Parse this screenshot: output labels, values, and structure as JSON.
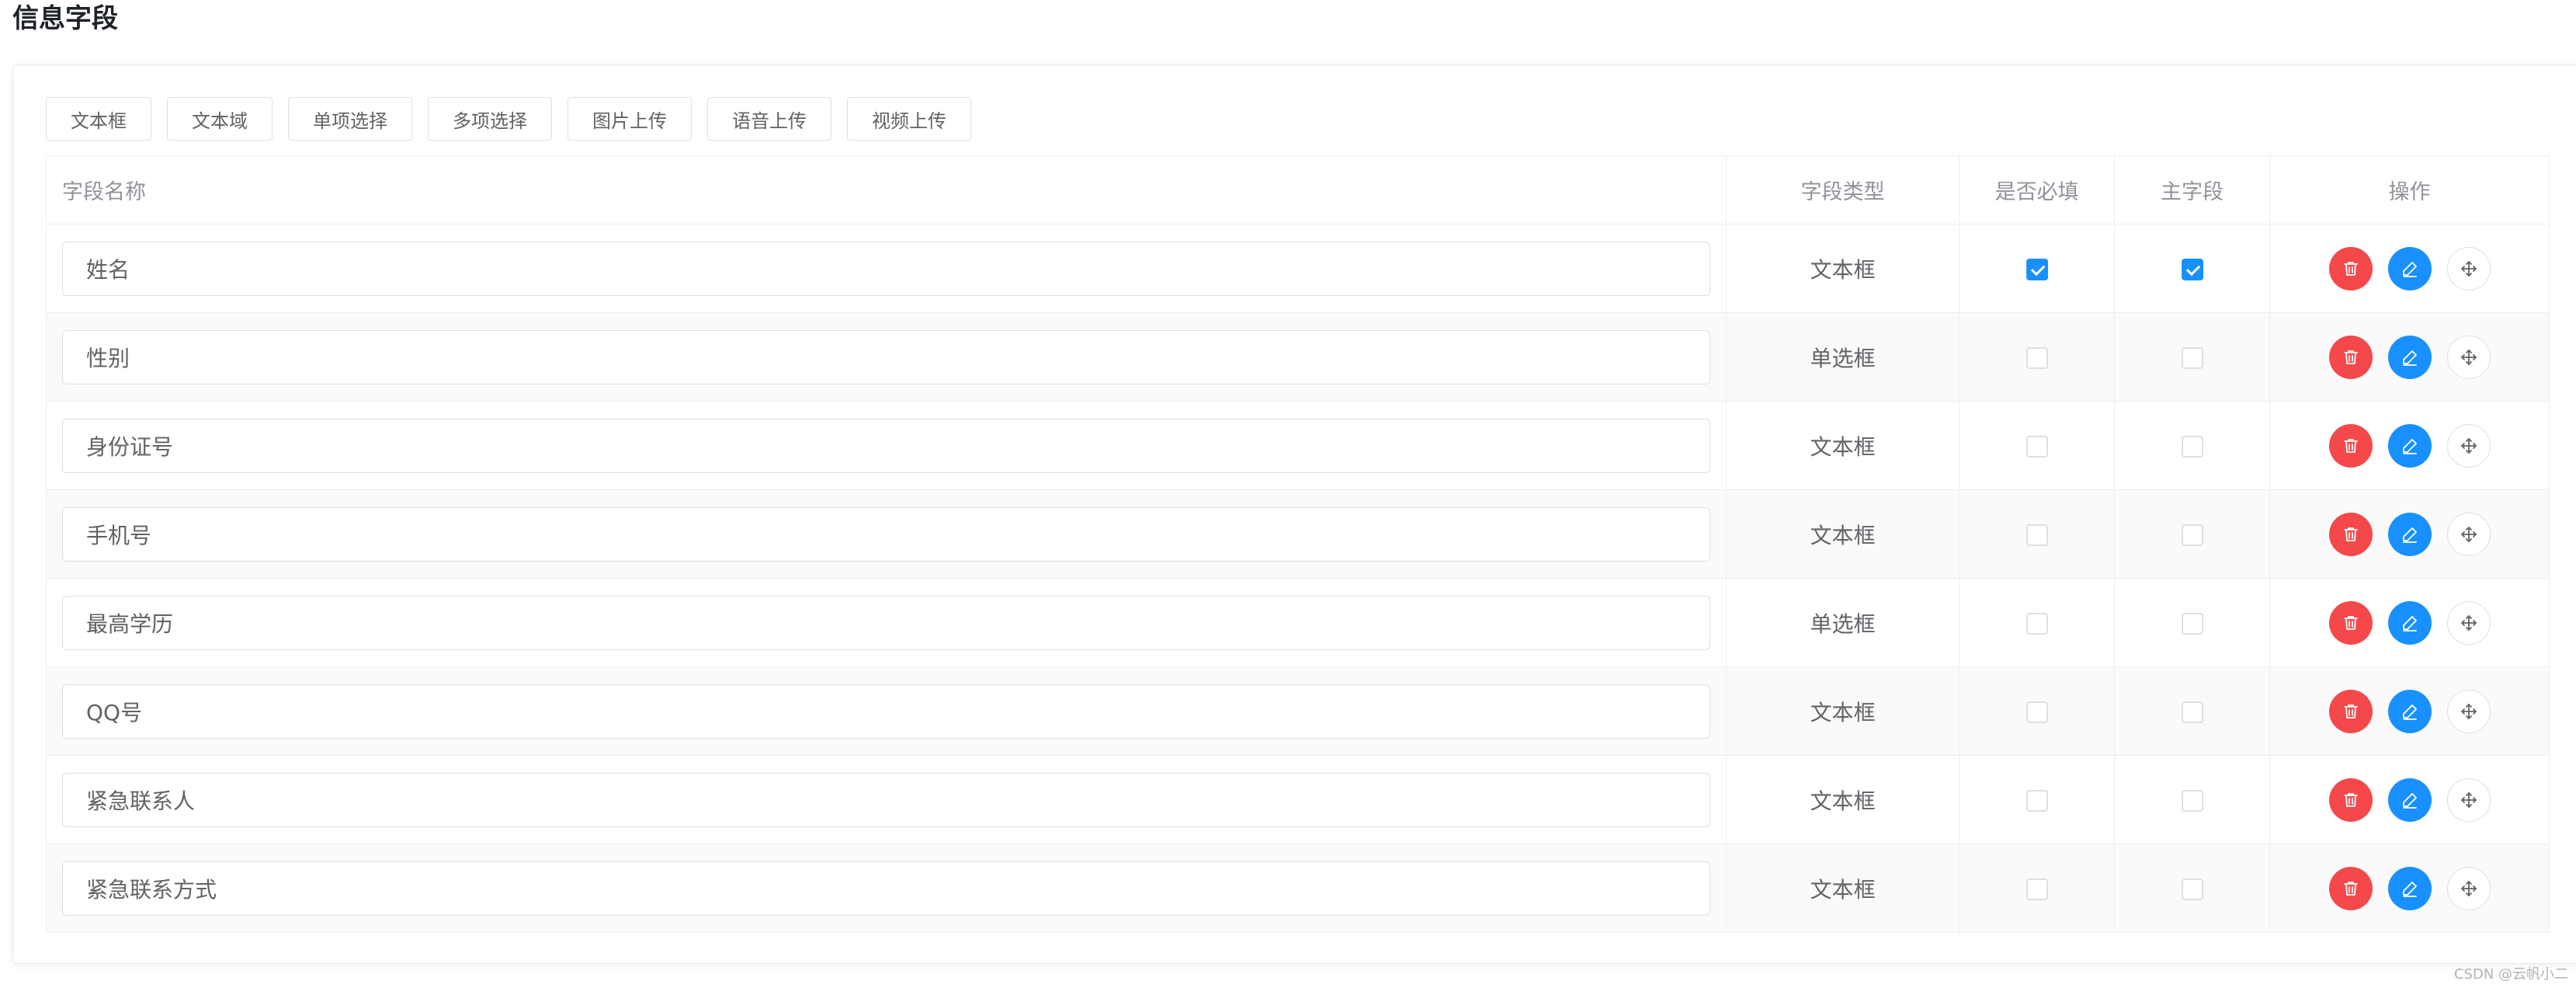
{
  "page": {
    "title": "信息字段"
  },
  "toolbar": {
    "buttons": [
      "文本框",
      "文本域",
      "单项选择",
      "多项选择",
      "图片上传",
      "语音上传",
      "视频上传"
    ]
  },
  "table": {
    "headers": {
      "name": "字段名称",
      "type": "字段类型",
      "required": "是否必填",
      "primary": "主字段",
      "ops": "操作"
    },
    "rows": [
      {
        "name": "姓名",
        "type": "文本框",
        "required": true,
        "primary": true
      },
      {
        "name": "性别",
        "type": "单选框",
        "required": false,
        "primary": false
      },
      {
        "name": "身份证号",
        "type": "文本框",
        "required": false,
        "primary": false
      },
      {
        "name": "手机号",
        "type": "文本框",
        "required": false,
        "primary": false
      },
      {
        "name": "最高学历",
        "type": "单选框",
        "required": false,
        "primary": false
      },
      {
        "name": "QQ号",
        "type": "文本框",
        "required": false,
        "primary": false
      },
      {
        "name": "紧急联系人",
        "type": "文本框",
        "required": false,
        "primary": false
      },
      {
        "name": "紧急联系方式",
        "type": "文本框",
        "required": false,
        "primary": false
      }
    ]
  },
  "icons": {
    "delete": "trash-icon",
    "edit": "pencil-icon",
    "move": "move-icon"
  },
  "colors": {
    "primary": "#1890ff",
    "danger": "#f5484a",
    "border": "#ebeef5"
  },
  "watermark": "CSDN @云帆小二"
}
